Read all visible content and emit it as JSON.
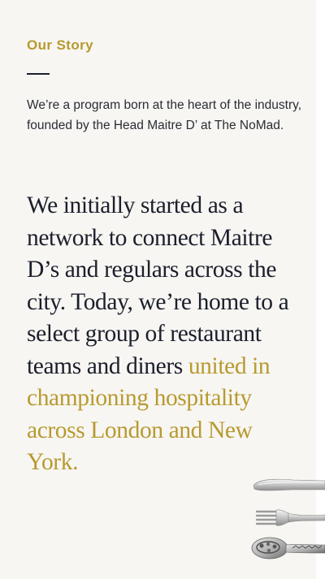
{
  "story": {
    "eyebrow": "Our Story",
    "intro": "We’re a program born at the heart of the industry, founded by the Head Maitre D’ at The NoMad.",
    "statement_main": "We initially started as a network to connect Maitre D’s and regulars across the city. Today, we’re home to a select group of restaurant teams and diners ",
    "statement_accent": "united in championing hospitality across London and New York."
  },
  "colors": {
    "accent": "#b89a2f",
    "text_dark": "#1c1f2b",
    "card_background": "#f7f6f3"
  },
  "icons": {
    "cutlery": "cutlery-illustration"
  }
}
